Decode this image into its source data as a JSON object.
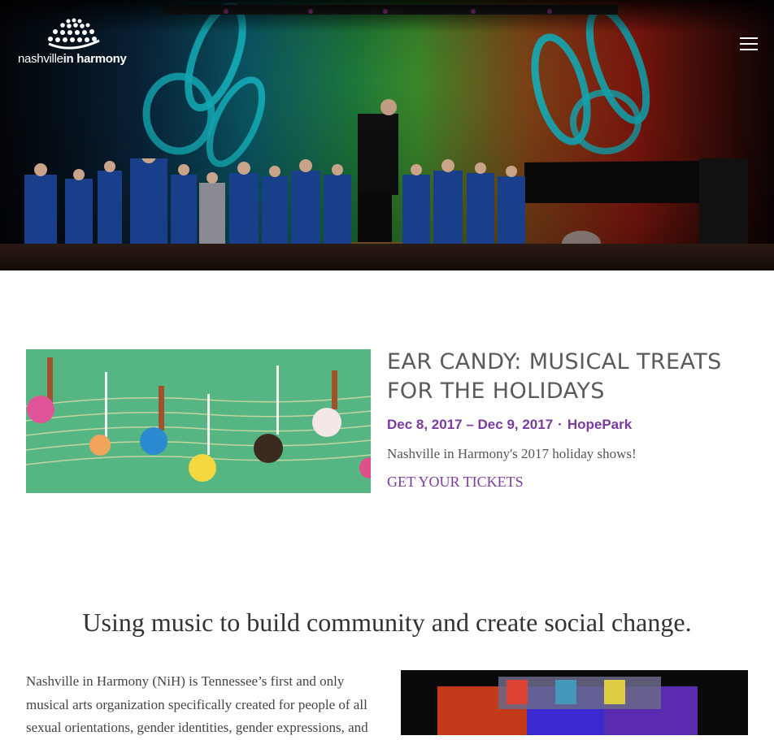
{
  "logo": {
    "text_light": "nashville",
    "text_bold": "in harmony"
  },
  "header": {
    "menu_icon": "hamburger-menu-icon"
  },
  "event": {
    "title": "EAR CANDY: MUSICAL TREATS FOR THE HOLIDAYS",
    "dates": "Dec 8, 2017 – Dec 9, 2017",
    "separator": "·",
    "venue": "HopePark",
    "description": "Nashville in Harmony's 2017 holiday shows!",
    "cta": "GET YOUR TICKETS"
  },
  "mission": {
    "heading": "Using music to build community and create social change.",
    "body": "Nashville in Harmony (NiH) is Tennessee’s first and only musical arts organization specifically created for people of all sexual orientations, gender identities, gender expressions, and"
  },
  "colors": {
    "accent": "#7b3aa0",
    "heading_gray": "#5a5a5a",
    "body_text": "#444444"
  }
}
